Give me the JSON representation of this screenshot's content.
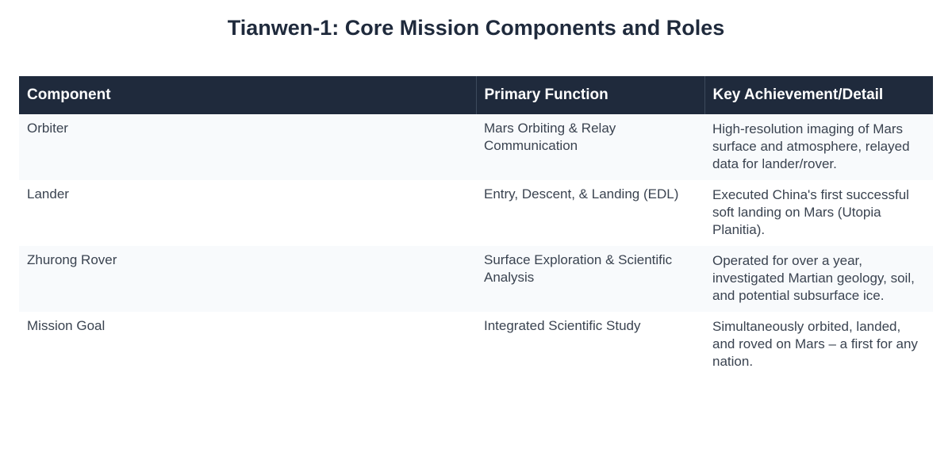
{
  "page": {
    "title": "Tianwen-1: Core Mission Components and Roles"
  },
  "table": {
    "headers": [
      "Component",
      "Primary Function",
      "Key Achievement/Detail"
    ],
    "rows": [
      {
        "component": "Orbiter",
        "function": "Mars Orbiting & Relay Communication",
        "detail": "High-resolution imaging of Mars surface and atmosphere, relayed data for lander/rover."
      },
      {
        "component": "Lander",
        "function": "Entry, Descent, & Landing (EDL)",
        "detail": "Executed China's first successful soft landing on Mars (Utopia Planitia)."
      },
      {
        "component": "Zhurong Rover",
        "function": "Surface Exploration & Scientific Analysis",
        "detail": "Operated for over a year, investigated Martian geology, soil, and potential subsurface ice."
      },
      {
        "component": "Mission Goal",
        "function": "Integrated Scientific Study",
        "detail": "Simultaneously orbited, landed, and roved on Mars – a first for any nation."
      }
    ]
  },
  "colors": {
    "header_bg": "#1f2a3c",
    "header_text": "#ffffff",
    "row_alt_bg": "#f8fafc",
    "body_text": "#3a4350"
  }
}
